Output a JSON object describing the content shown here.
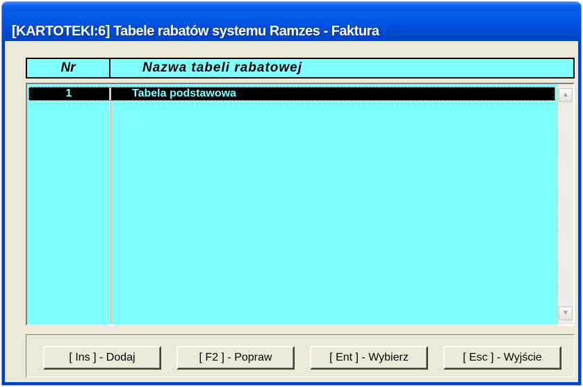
{
  "window": {
    "title": "[KARTOTEKI:6]  Tabele rabatów systemu Ramzes - Faktura"
  },
  "table": {
    "columns": {
      "nr": "Nr",
      "name": "Nazwa tabeli rabatowej"
    },
    "rows": [
      {
        "nr": "1",
        "name": "Tabela podstawowa",
        "selected": true
      }
    ]
  },
  "scrollbar": {
    "up_icon": "scroll-up-arrow",
    "down_icon": "scroll-down-arrow",
    "up_glyph": "▲",
    "down_glyph": "▼"
  },
  "buttons": {
    "add": "[ Ins ] - Dodaj",
    "edit": "[ F2 ] - Popraw",
    "select": "[ Ent ] - Wybierz",
    "exit": "[ Esc ] - Wyjście"
  },
  "colors": {
    "list_background": "#80ffff",
    "selection_background": "#000000",
    "selection_text": "#80ffff",
    "titlebar": "#0055e5"
  }
}
